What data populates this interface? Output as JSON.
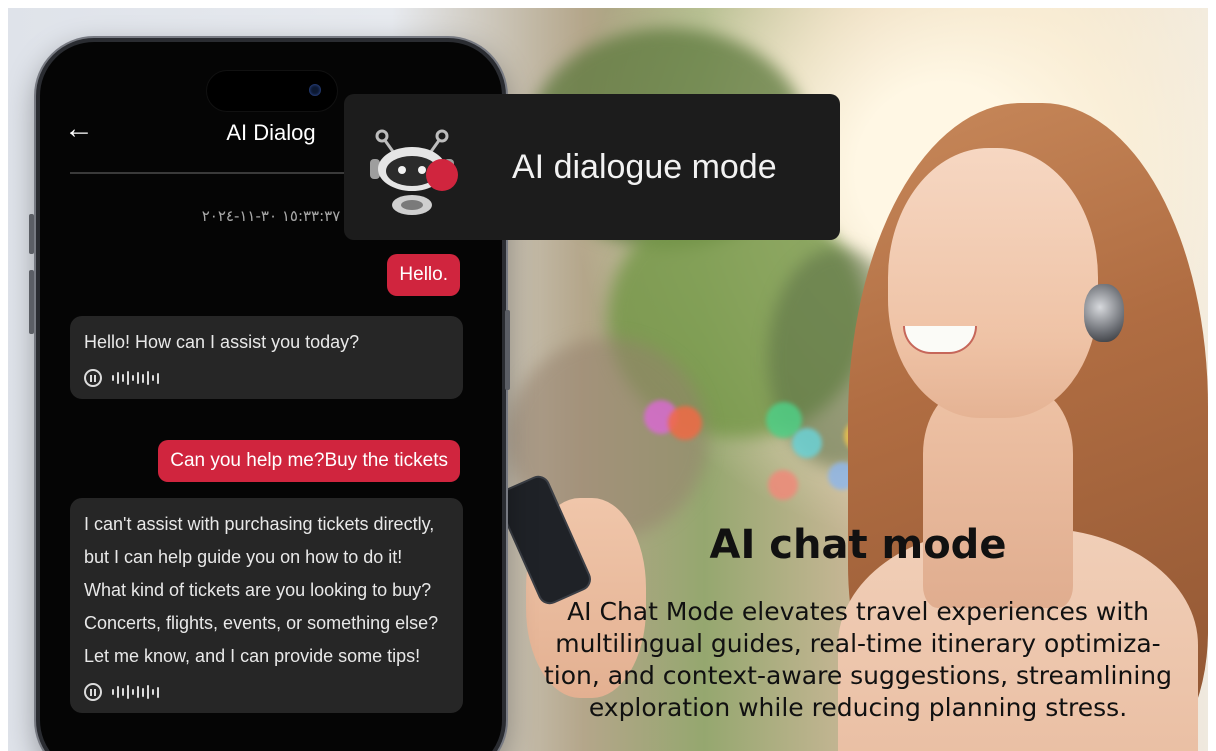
{
  "chat_screen": {
    "title": "AI Dialog",
    "back_icon": "←",
    "timestamp": "١٥:٣٣:٣٧ ٣٠-١١-٢٠٢٤",
    "messages": [
      {
        "role": "user",
        "text": "Hello."
      },
      {
        "role": "ai",
        "text": "Hello! How can I assist you today?"
      },
      {
        "role": "user",
        "text": "Can you help me?Buy the tickets"
      },
      {
        "role": "ai",
        "text": "I can't assist with purchasing tickets directly, but I can help guide you on how to do it! What kind of tickets are you looking to buy? Concerts, flights, events, or something else? Let me know, and I can provide some tips!"
      }
    ]
  },
  "mode_card": {
    "label": "AI dialogue mode",
    "icon": "robot-icon",
    "accent": "#d0253e"
  },
  "promo": {
    "headline": "AI chat mode",
    "description": "AI Chat Mode elevates travel experiences with multilingual guides, real-time itinerary optimiza-tion, and context-aware suggestions, streamlining exploration while reducing planning stress."
  },
  "colors": {
    "user_bubble": "#d0253e",
    "ai_bubble": "#262626",
    "phone_bg": "#050505"
  }
}
